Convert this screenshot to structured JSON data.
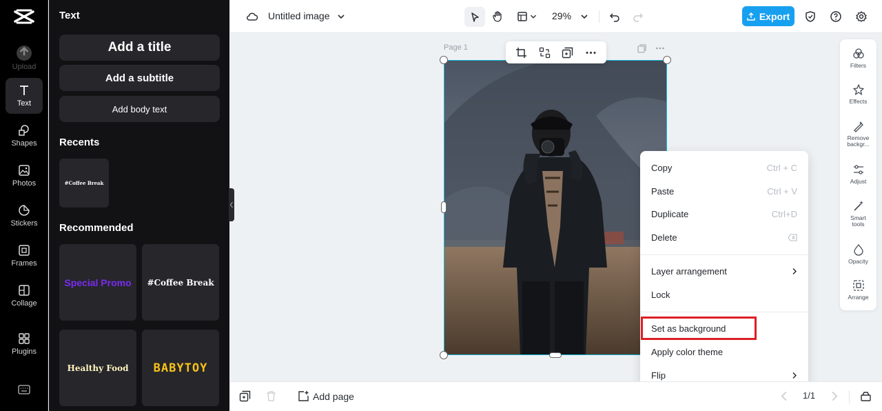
{
  "rail": {
    "items": [
      {
        "label": "Upload"
      },
      {
        "label": "Text"
      },
      {
        "label": "Shapes"
      },
      {
        "label": "Photos"
      },
      {
        "label": "Stickers"
      },
      {
        "label": "Frames"
      },
      {
        "label": "Collage"
      },
      {
        "label": "Plugins"
      }
    ]
  },
  "panel": {
    "title": "Text",
    "buttons": {
      "title": "Add a title",
      "subtitle": "Add a subtitle",
      "body": "Add body text"
    },
    "recents_heading": "Recents",
    "recents": [
      "#Coffee Break"
    ],
    "recommended_heading": "Recommended",
    "recommended": [
      "Special Promo",
      "#Coffee Break",
      "Healthy Food",
      "BABYTOY"
    ]
  },
  "topbar": {
    "doc_title": "Untitled image",
    "zoom": "29%",
    "export_label": "Export"
  },
  "canvas": {
    "page_label": "Page 1"
  },
  "tools": [
    {
      "label": "Filters"
    },
    {
      "label": "Effects"
    },
    {
      "label": "Remove backgr..."
    },
    {
      "label": "Adjust"
    },
    {
      "label": "Smart tools"
    },
    {
      "label": "Opacity"
    },
    {
      "label": "Arrange"
    }
  ],
  "context_menu": {
    "items": [
      {
        "label": "Copy",
        "shortcut": "Ctrl + C"
      },
      {
        "label": "Paste",
        "shortcut": "Ctrl + V"
      },
      {
        "label": "Duplicate",
        "shortcut": "Ctrl+D"
      },
      {
        "label": "Delete",
        "shortcut": ""
      },
      {
        "label": "Layer arrangement",
        "shortcut": ""
      },
      {
        "label": "Lock",
        "shortcut": ""
      },
      {
        "label": "Set as background",
        "shortcut": ""
      },
      {
        "label": "Apply color theme",
        "shortcut": ""
      },
      {
        "label": "Flip",
        "shortcut": ""
      }
    ],
    "highlighted_item": "Set as background",
    "highlight_color": "#dc1f26"
  },
  "bottombar": {
    "add_page_label": "Add page",
    "pagination": "1/1"
  },
  "colors": {
    "accent": "#18a0f0",
    "selection": "#17b6d8",
    "rail_bg": "#000000",
    "panel_bg": "#121214"
  }
}
